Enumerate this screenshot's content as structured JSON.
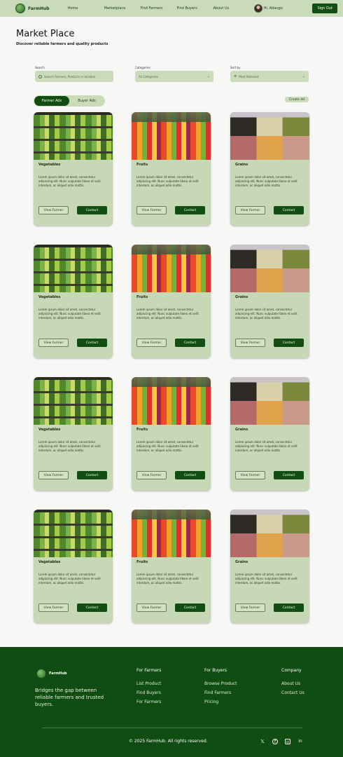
{
  "nav": {
    "brand": "FarmHub",
    "links": [
      "Home",
      "Marketplace",
      "Find Farmers",
      "Find Buyers",
      "About Us"
    ],
    "user_name": "Hi, Adaugo",
    "signout_label": "Sign Out"
  },
  "header": {
    "title": "Market Place",
    "subtitle": "Discover reliable farmers and quality products"
  },
  "filters": {
    "search_label": "Search",
    "search_placeholder": "Search Farmers, Products or location",
    "category_label": "Categories",
    "category_value": "All Categories",
    "sort_label": "Sort by",
    "sort_value": "Most Relevant"
  },
  "tabs": [
    "Farmer Ads",
    "Buyer Ads"
  ],
  "create_ad_label": "Create Ad",
  "card_buttons": {
    "view": "View Farmer",
    "contact": "Contact"
  },
  "cards": [
    {
      "name": "Vegetables",
      "desc": "Lorem ipsum dolor sit amet, consectetur adipiscing elit. Nunc vulputate libero et velit interdum, ac aliquet odio mattis.",
      "image": "vegetables"
    },
    {
      "name": "Fruits",
      "desc": "Lorem ipsum dolor sit amet, consectetur adipiscing elit. Nunc vulputate libero et velit interdum, ac aliquet odio mattis.",
      "image": "fruits"
    },
    {
      "name": "Grains",
      "desc": "Lorem ipsum dolor sit amet, consectetur adipiscing elit. Nunc vulputate libero et velit interdum, ac aliquet odio mattis.",
      "image": "grains"
    },
    {
      "name": "Vegetables",
      "desc": "Lorem ipsum dolor sit amet, consectetur adipiscing elit. Nunc vulputate libero et velit interdum, ac aliquet odio mattis.",
      "image": "vegetables"
    },
    {
      "name": "Fruits",
      "desc": "Lorem ipsum dolor sit amet, consectetur adipiscing elit. Nunc vulputate libero et velit interdum, ac aliquet odio mattis.",
      "image": "fruits"
    },
    {
      "name": "Grains",
      "desc": "Lorem ipsum dolor sit amet, consectetur adipiscing elit. Nunc vulputate libero et velit interdum, ac aliquet odio mattis.",
      "image": "grains"
    },
    {
      "name": "Vegetables",
      "desc": "Lorem ipsum dolor sit amet, consectetur adipiscing elit. Nunc vulputate libero et velit interdum, ac aliquet odio mattis.",
      "image": "vegetables"
    },
    {
      "name": "Fruits",
      "desc": "Lorem ipsum dolor sit amet, consectetur adipiscing elit. Nunc vulputate libero et velit interdum, ac aliquet odio mattis.",
      "image": "fruits"
    },
    {
      "name": "Grains",
      "desc": "Lorem ipsum dolor sit amet, consectetur adipiscing elit. Nunc vulputate libero et velit interdum, ac aliquet odio mattis.",
      "image": "grains"
    },
    {
      "name": "Vegetables",
      "desc": "Lorem ipsum dolor sit amet, consectetur adipiscing elit. Nunc vulputate libero et velit interdum, ac aliquet odio mattis.",
      "image": "vegetables"
    },
    {
      "name": "Fruits",
      "desc": "Lorem ipsum dolor sit amet, consectetur adipiscing elit. Nunc vulputate libero et velit interdum, ac aliquet odio mattis.",
      "image": "fruits"
    },
    {
      "name": "Grains",
      "desc": "Lorem ipsum dolor sit amet, consectetur adipiscing elit. Nunc vulputate libero et velit interdum, ac aliquet odio mattis.",
      "image": "grains"
    }
  ],
  "footer": {
    "brand": "FarmHub",
    "tagline": "Bridges the gap between reliable farmers and trusted buyers.",
    "columns": [
      {
        "title": "For Farmers",
        "links": [
          "List Product",
          "Find Buyers",
          "For Farmers"
        ]
      },
      {
        "title": "For Buyers",
        "links": [
          "Browse Product",
          "Find Farmers",
          "Pricing"
        ]
      },
      {
        "title": "Company",
        "links": [
          "About Us",
          "Contact Us"
        ]
      }
    ],
    "copyright": "© 2025 FarmHub. All rights reserved.",
    "social": [
      "x-icon",
      "facebook-icon",
      "instagram-icon",
      "linkedin-icon"
    ]
  },
  "colors": {
    "primary": "#124d12",
    "panel": "#c9dbb8",
    "card": "#c6d8b6",
    "footer": "#104d12"
  }
}
